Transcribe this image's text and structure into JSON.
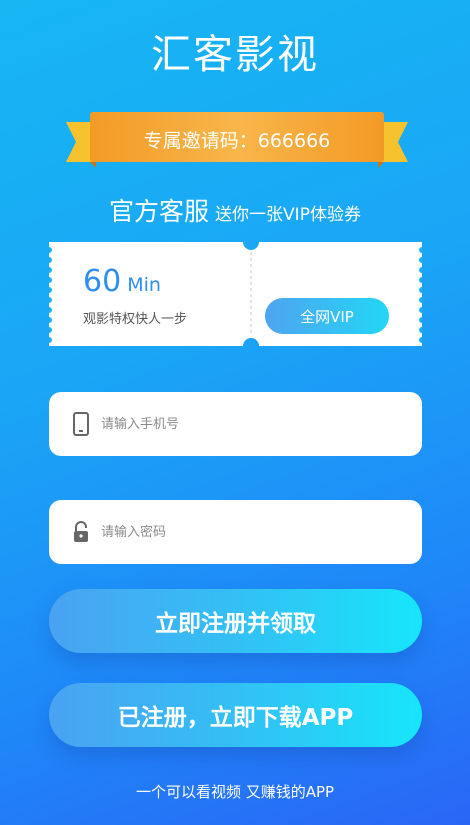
{
  "app_title": "汇客影视",
  "invite": {
    "text": "专属邀请码：666666"
  },
  "service": {
    "title": "官方客服",
    "subtitle": "送你一张VIP体验券"
  },
  "ticket": {
    "minutes": "60",
    "unit": "Min",
    "description": "观影特权快人一步",
    "vip_button": "全网VIP"
  },
  "phone_field": {
    "placeholder": "请输入手机号",
    "icon": "phone-icon"
  },
  "password_field": {
    "placeholder": "请输入密码",
    "icon": "lock-icon"
  },
  "register_button": "立即注册并领取",
  "download_button": "已注册，立即下载APP",
  "slogan": "一个可以看视频 又赚钱的APP",
  "colors": {
    "accent_blue": "#2f8ff0",
    "ribbon_orange": "#f5a12a",
    "ribbon_yellow": "#f7d23a"
  }
}
